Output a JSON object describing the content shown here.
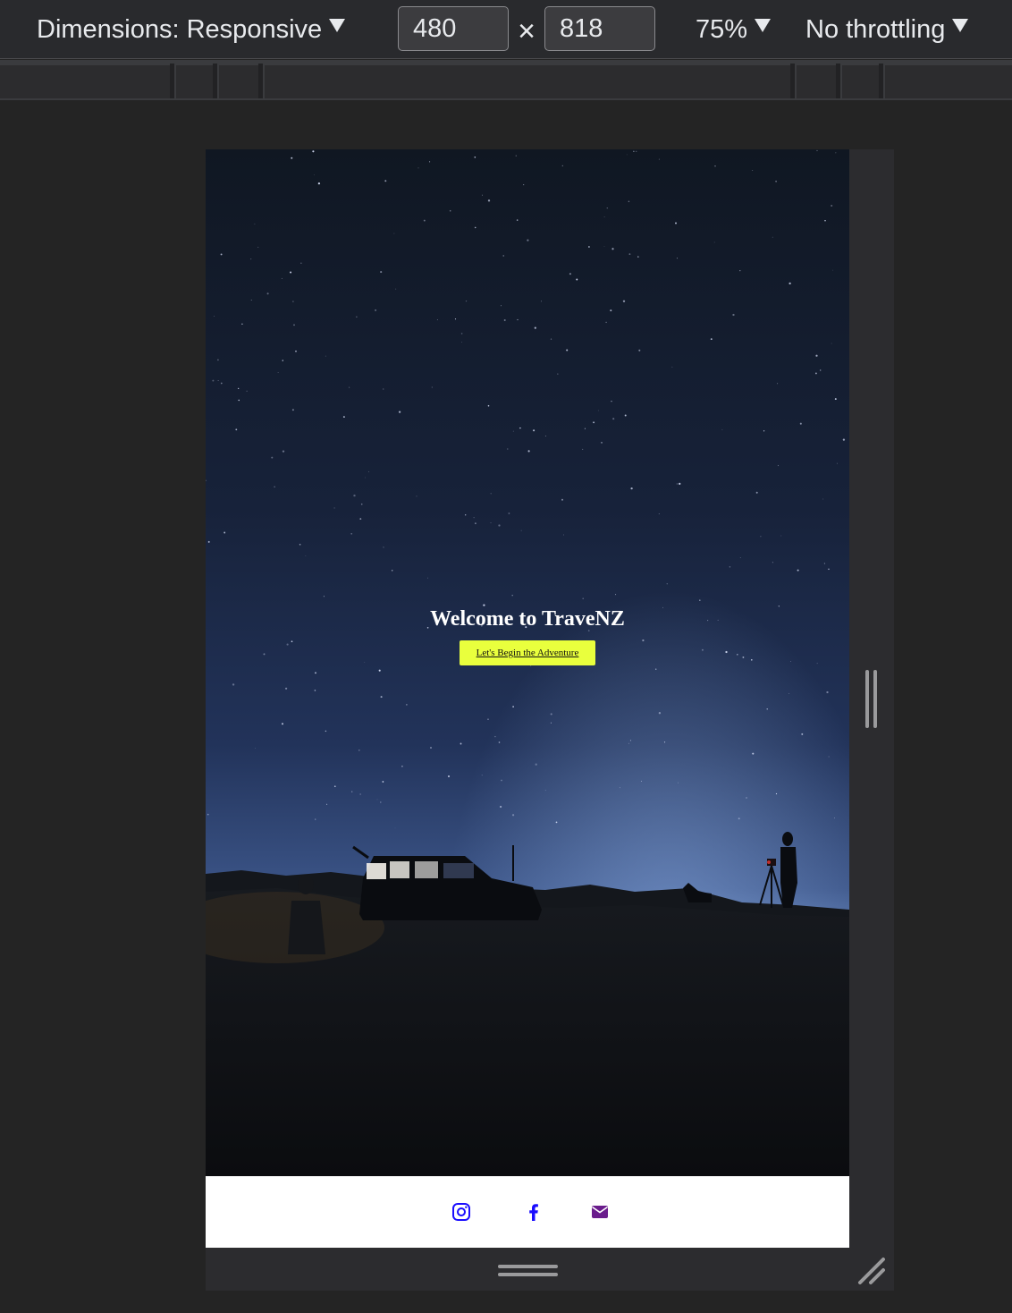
{
  "toolbar": {
    "dimensions_label": "Dimensions: Responsive",
    "width_value": "480",
    "times_symbol": "×",
    "height_value": "818",
    "zoom_label": "75%",
    "throttling_label": "No throttling"
  },
  "page": {
    "hero": {
      "title": "Welcome to TraveNZ",
      "cta_label": "Let's Begin the Adventure",
      "cta_color": "#e9ff3d"
    },
    "footer": {
      "social_icons": [
        "instagram-icon",
        "facebook-icon",
        "envelope-icon"
      ],
      "icon_colors": {
        "instagram": "#1a0dff",
        "facebook": "#1a0dff",
        "email": "#6a1c8c"
      }
    }
  },
  "colors": {
    "devtools_bg": "#242424",
    "toolbar_bg": "#292a2d",
    "night_sky_top": "#101722",
    "night_sky_horizon": "#6d8fc7"
  }
}
